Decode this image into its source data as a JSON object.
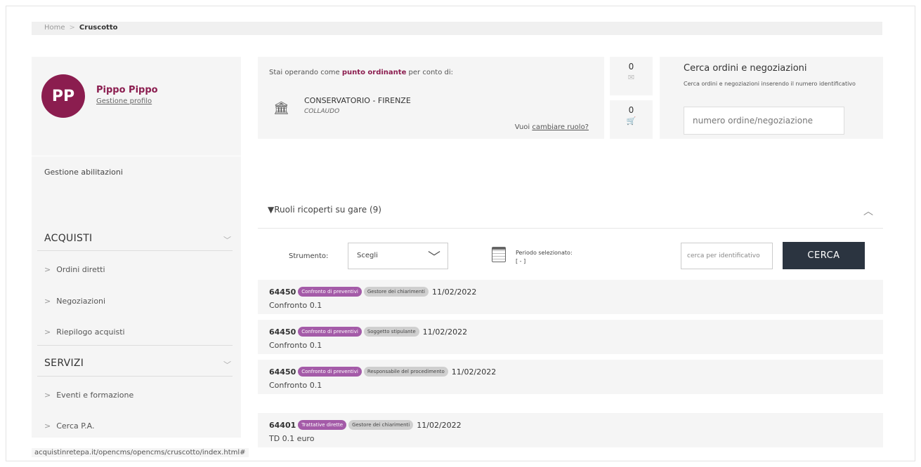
{
  "breadcrumb": {
    "home": "Home",
    "separator": ">",
    "current": "Cruscotto"
  },
  "profile": {
    "initials": "PP",
    "name": "Pippo Pippo",
    "manage_link": "Gestione profilo"
  },
  "sidebar": {
    "abilitazioni": "Gestione abilitazioni",
    "sections": [
      {
        "title": "ACQUISTI",
        "items": [
          "Ordini diretti",
          "Negoziazioni",
          "Riepilogo acquisti"
        ]
      },
      {
        "title": "SERVIZI",
        "items": [
          "Eventi e formazione",
          "Cerca P.A."
        ]
      }
    ]
  },
  "status_bar": "acquistinretepa.it/opencms/opencms/cruscotto/index.html#",
  "role": {
    "prefix": "Stai operando come",
    "role_name": "punto ordinante",
    "suffix": "per conto di:",
    "org_name": "CONSERVATORIO - FIRENZE",
    "org_sub": "COLLAUDO",
    "change_prefix": "Vuoi",
    "change_link": "cambiare ruolo?"
  },
  "counters": {
    "messages": "0",
    "cart": "0",
    "message_icon": "envelope-icon",
    "cart_icon": "cart-icon"
  },
  "search": {
    "title": "Cerca ordini e negoziazioni",
    "description": "Cerca ordini e negoziazioni inserendo il numero identificativo",
    "placeholder": "numero ordine/negoziazione"
  },
  "panel": {
    "title": "Ruoli ricoperti su gare (9)",
    "filter_label": "Strumento:",
    "select_value": "Scegli",
    "period_label": "Periodo selezionato:",
    "period_value": "[ - ]",
    "id_placeholder": "cerca per identificativo",
    "search_button": "CERCA"
  },
  "results": [
    {
      "id": "64450",
      "type": "Confronto di preventivi",
      "role": "Gestore dei chiarimenti",
      "date": "11/02/2022",
      "title": "Confronto 0.1"
    },
    {
      "id": "64450",
      "type": "Confronto di preventivi",
      "role": "Soggetto stipulante",
      "date": "11/02/2022",
      "title": "Confronto 0.1"
    },
    {
      "id": "64450",
      "type": "Confronto di preventivi",
      "role": "Responsabile del procedimento",
      "date": "11/02/2022",
      "title": "Confronto 0.1"
    },
    {
      "id": "64401",
      "type": "Trattative dirette",
      "role": "Gestore dei chiarimenti",
      "date": "11/02/2022",
      "title": "TD 0.1 euro"
    }
  ],
  "colors": {
    "brand": "#8b1d4f",
    "badge_type": "#a45ba8",
    "badge_role": "#cfcfcf",
    "button": "#2b3440",
    "panel_bg": "#f5f5f5"
  }
}
